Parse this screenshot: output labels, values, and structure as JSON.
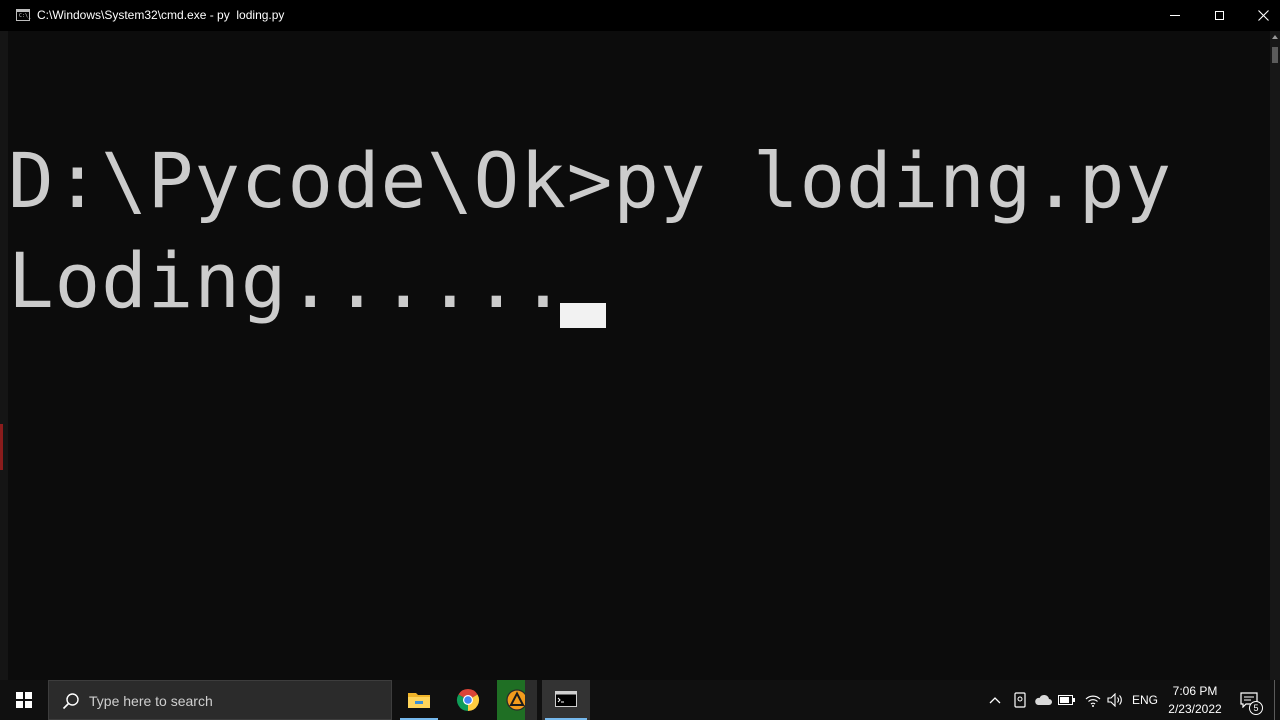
{
  "window": {
    "title": "C:\\Windows\\System32\\cmd.exe - py  loding.py",
    "app_icon_text": "C:\\_"
  },
  "console": {
    "lines": [
      "D:\\Pycode\\Ok>py loding.py",
      "Loding......"
    ],
    "text_color": "#cccccc",
    "background": "#0c0c0c"
  },
  "taskbar": {
    "search_placeholder": "Type here to search",
    "pinned_apps": [
      "file-explorer",
      "google-chrome",
      "aimp-player",
      "command-prompt"
    ],
    "tray": {
      "language": "ENG",
      "time": "7:06 PM",
      "date": "2/23/2022",
      "notification_count": "5"
    },
    "accent": "#76b9ed"
  }
}
